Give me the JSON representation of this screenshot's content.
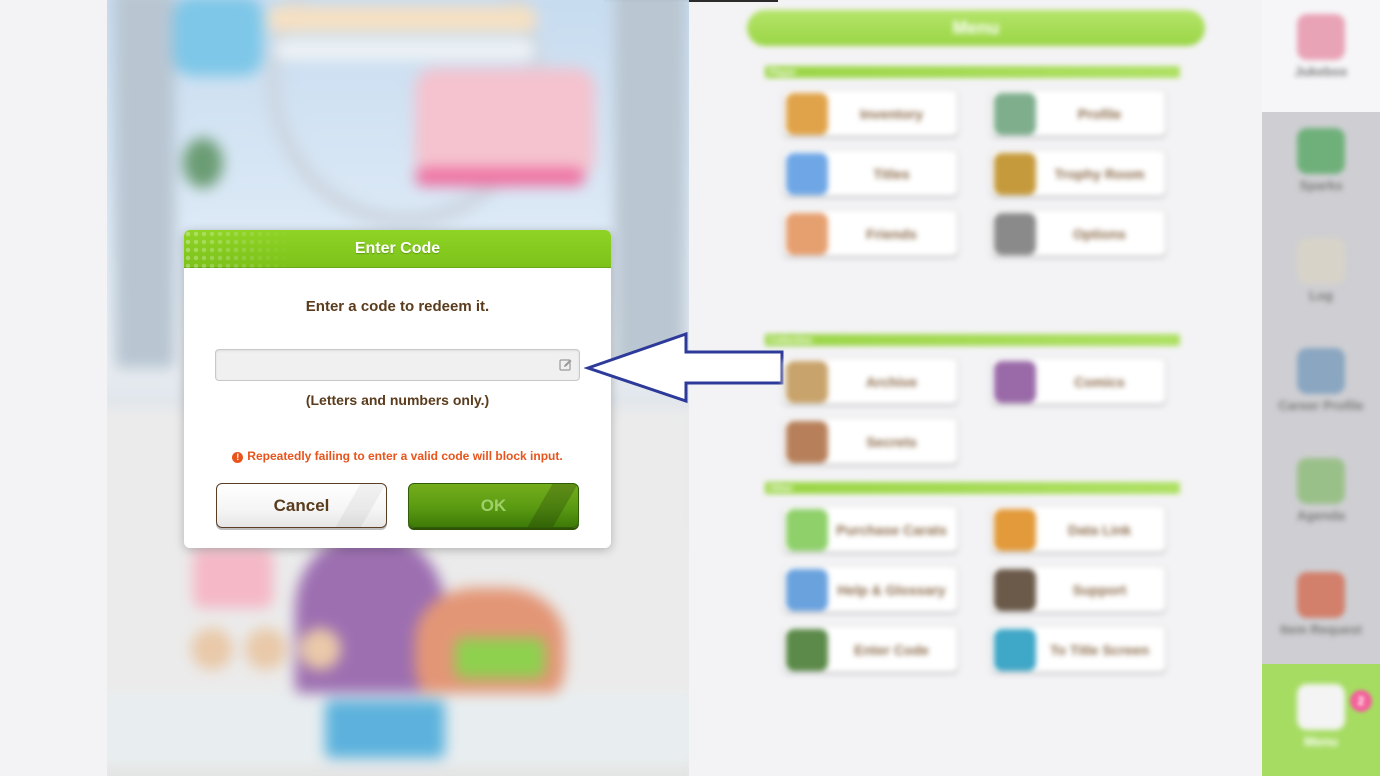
{
  "dialog": {
    "title": "Enter Code",
    "instruction": "Enter a code to redeem it.",
    "input_value": "",
    "input_placeholder": "",
    "hint": "(Letters and numbers only.)",
    "warning": "Repeatedly failing to enter a valid code will block input.",
    "warning_icon": "!",
    "cancel_label": "Cancel",
    "ok_label": "OK"
  },
  "menu": {
    "title": "Menu",
    "sections": [
      {
        "label": "Player"
      },
      {
        "label": "Collection"
      },
      {
        "label": "Other"
      }
    ],
    "items": [
      {
        "label": "Inventory",
        "icon": "inventory-icon",
        "color": "#e0a34a"
      },
      {
        "label": "Profile",
        "icon": "profile-icon",
        "color": "#7fae8d"
      },
      {
        "label": "Titles",
        "icon": "titles-icon",
        "color": "#6fa7e6"
      },
      {
        "label": "Trophy Room",
        "icon": "trophy-icon",
        "color": "#c59a3c"
      },
      {
        "label": "Friends",
        "icon": "friends-icon",
        "color": "#e6a070"
      },
      {
        "label": "Options",
        "icon": "options-gear-icon",
        "color": "#8a8a8a"
      },
      {
        "label": "Archive",
        "icon": "archive-icon",
        "color": "#c8a36b"
      },
      {
        "label": "Comics",
        "icon": "comics-icon",
        "color": "#9a6aa8"
      },
      {
        "label": "Secrets",
        "icon": "secrets-icon",
        "color": "#b7805a"
      },
      {
        "label": "Purchase Carats",
        "icon": "carats-icon",
        "color": "#8fd06a"
      },
      {
        "label": "Data Link",
        "icon": "data-link-icon",
        "color": "#e29a3a"
      },
      {
        "label": "Help & Glossary",
        "icon": "help-icon",
        "color": "#6aa2de"
      },
      {
        "label": "Support",
        "icon": "support-icon",
        "color": "#6b5a4a"
      },
      {
        "label": "Enter Code",
        "icon": "enter-code-icon",
        "color": "#5c8a4a"
      },
      {
        "label": "To Title Screen",
        "icon": "title-screen-icon",
        "color": "#3fa7c7"
      }
    ]
  },
  "sidebar": {
    "items": [
      {
        "label": "Jukebox",
        "icon": "jukebox-icon",
        "color": "#e9a3b6"
      },
      {
        "label": "Sparks",
        "icon": "sparks-icon",
        "color": "#6fb07a"
      },
      {
        "label": "Log",
        "icon": "log-icon",
        "color": "#d7d3c9"
      },
      {
        "label": "Career Profile",
        "icon": "career-profile-icon",
        "color": "#8aa6c1"
      },
      {
        "label": "Agenda",
        "icon": "agenda-icon",
        "color": "#9ac089"
      },
      {
        "label": "Item Request",
        "icon": "item-request-icon",
        "color": "#d27f6b"
      },
      {
        "label": "Menu",
        "icon": "menu-icon",
        "color": "#f4f4f4"
      }
    ],
    "badge": "2"
  },
  "colors": {
    "accent_green": "#7cc21a",
    "warning_orange": "#e8541b",
    "text_brown": "#5a3b1c",
    "arrow_blue": "#2d3a9a"
  }
}
